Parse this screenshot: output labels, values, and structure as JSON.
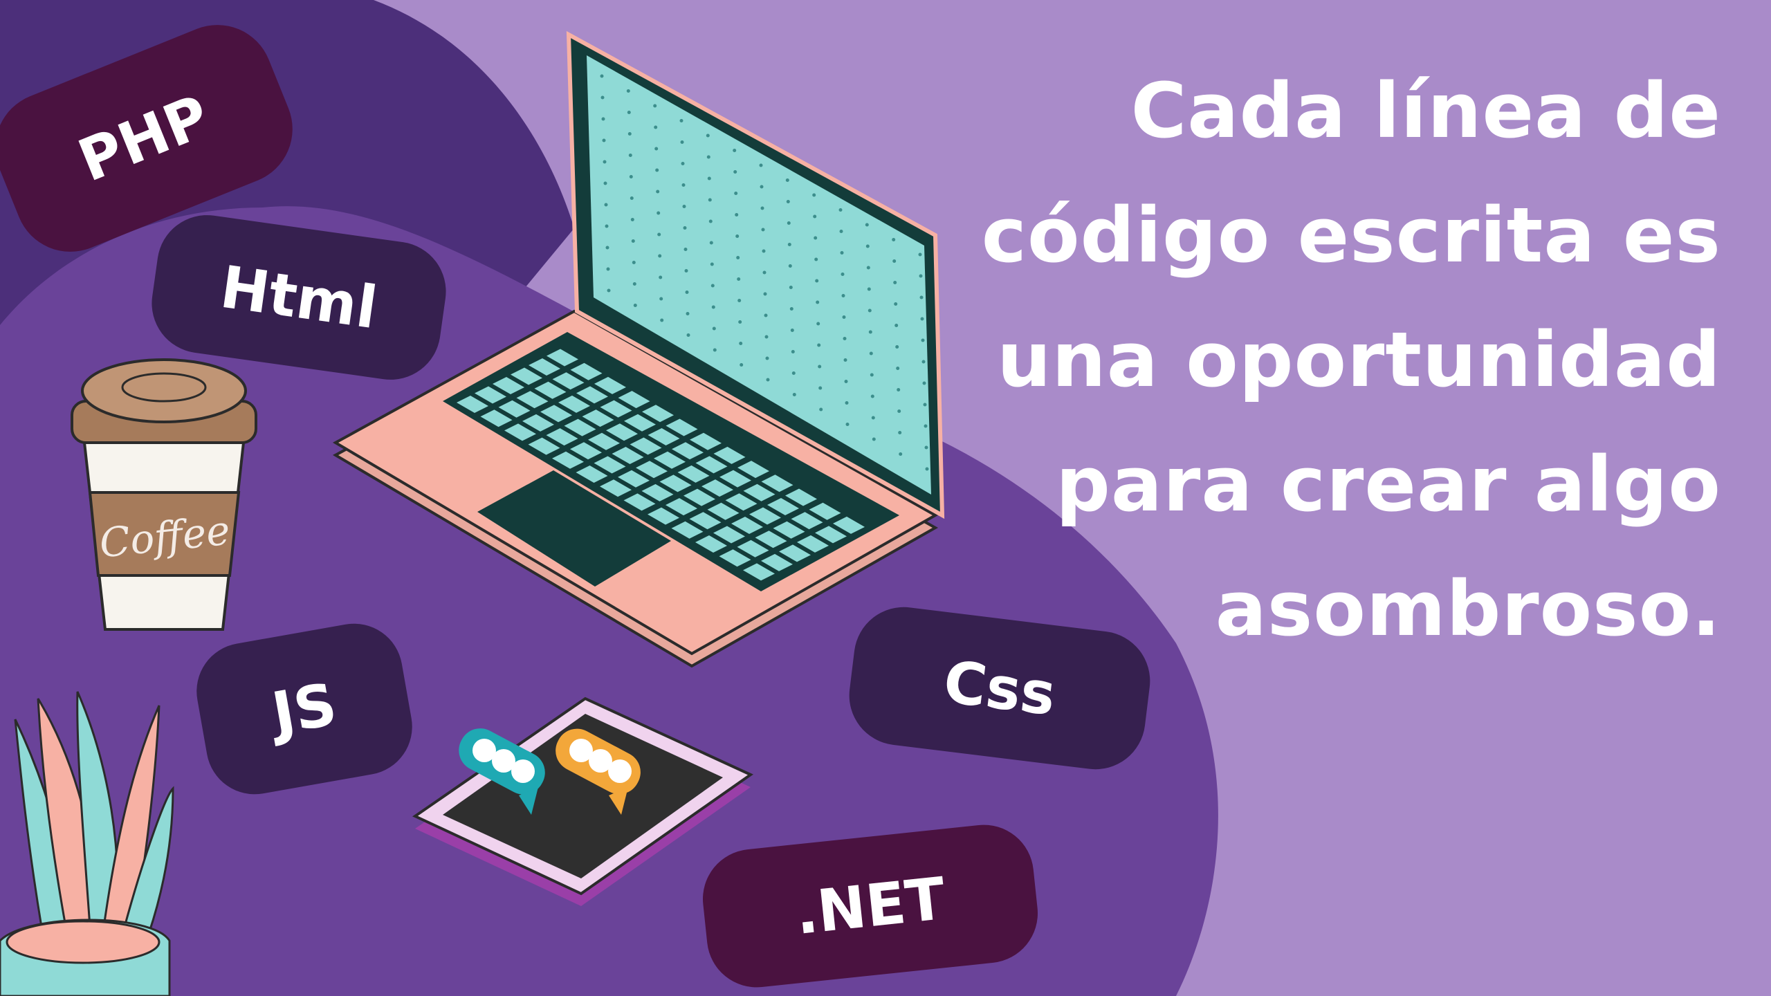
{
  "headline": {
    "lines": [
      "Cada línea de",
      "código escrita es",
      "una oportunidad",
      "para crear algo",
      "asombroso."
    ]
  },
  "tags": {
    "php": "PHP",
    "html": "Html",
    "js": "JS",
    "css": "Css",
    "net": ".NET"
  },
  "cup": {
    "label": "Coffee"
  },
  "icons": {
    "laptop": "laptop-icon",
    "phone": "smartphone-icon",
    "cup": "coffee-cup-icon",
    "plant": "potted-plant-icon",
    "chat": "chat-bubble-icon"
  },
  "colors": {
    "background": "#a98bc9",
    "blob_dark": "#4c2f7a",
    "blob_main": "#6a4399",
    "tag_dark": "#4a1240",
    "tag_navy": "#36204f",
    "laptop_body": "#f7b1a4",
    "laptop_screen": "#8fdad6",
    "laptop_dark": "#133c3a",
    "text": "#ffffff"
  }
}
